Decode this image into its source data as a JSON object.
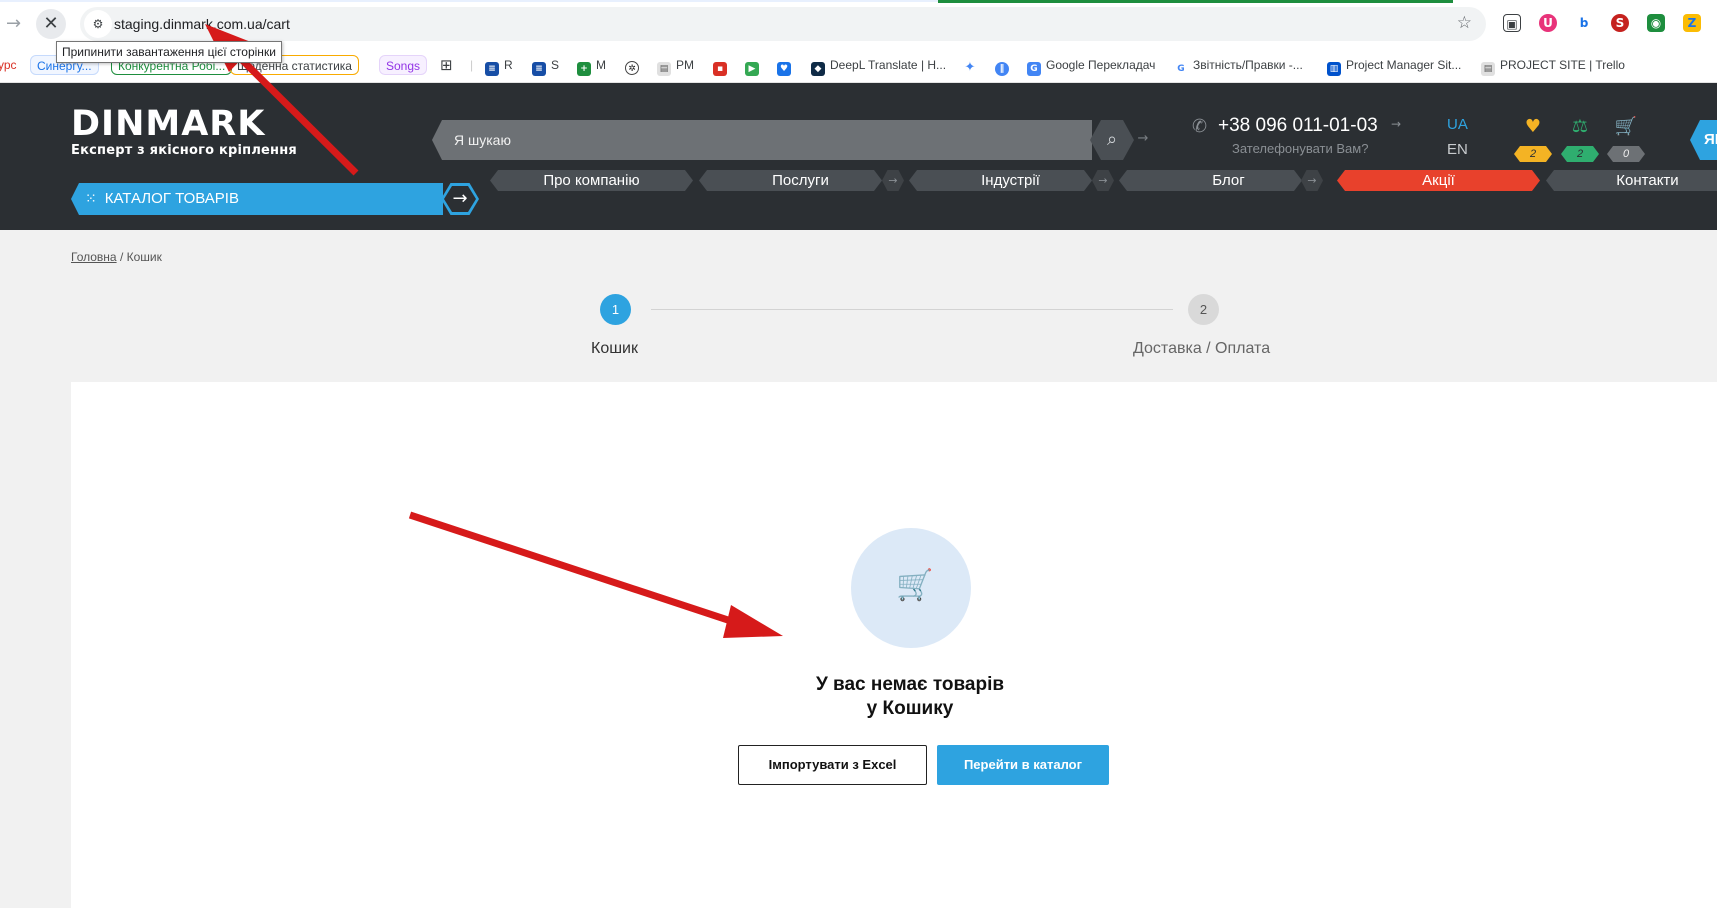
{
  "browser": {
    "url": "staging.dinmark.com.ua/cart",
    "tooltip": "Припинити завантаження цієї сторінки",
    "bookmarks": [
      {
        "label": "урс",
        "color": "#d93025"
      },
      {
        "label": "Синергу...",
        "color": "#1a73e8"
      },
      {
        "label": "Конкурентна Робі...",
        "color": "#1e8e3e"
      },
      {
        "label": "Щоденна статистика",
        "color": "#f9ab00"
      },
      {
        "label": "Songs",
        "color": "#9334e6"
      },
      {
        "label": "R",
        "color": "#174ea6"
      },
      {
        "label": "S",
        "color": "#174ea6"
      },
      {
        "label": "M",
        "color": "#1e8e3e"
      },
      {
        "label": "PM",
        "color": "#5f6368"
      },
      {
        "label": "DeepL Translate | Н...",
        "color": "#0f2b46"
      },
      {
        "label": "Google Перекладач",
        "color": "#1a73e8"
      },
      {
        "label": "Звітність/Правки -...",
        "color": "#4285f4"
      },
      {
        "label": "Project Manager Sit...",
        "color": "#0052cc"
      },
      {
        "label": "PROJECT SITE | Trello",
        "color": "#5f6368"
      }
    ]
  },
  "header": {
    "logo": "DINMARK",
    "tagline": "Експерт з якісного кріплення",
    "search_placeholder": "Я шукаю",
    "phone": "+38 096 011-01-03",
    "callback": "Зателефонувати Вам?",
    "lang_active": "UA",
    "lang_other": "EN",
    "favorites_count": "2",
    "compare_count": "2",
    "cart_count": "0",
    "side_cta": "ЯЦ",
    "catalog_label": "КАТАЛОГ ТОВАРІВ",
    "nav": {
      "about": "Про компанію",
      "services": "Послуги",
      "industries": "Індустрії",
      "blog": "Блог",
      "sales": "Акції",
      "contacts": "Контакти"
    },
    "colors": {
      "accent": "#2ea3e0",
      "sales": "#e8412c",
      "dark": "#2b2f33"
    }
  },
  "breadcrumb": {
    "home": "Головна",
    "separator": "/",
    "current": "Кошик"
  },
  "steps": [
    {
      "number": "1",
      "label": "Кошик"
    },
    {
      "number": "2",
      "label": "Доставка / Оплата"
    }
  ],
  "cart": {
    "empty_line1": "У вас немає товарів",
    "empty_line2": "у Кошику",
    "import_button": "Імпортувати з Excel",
    "catalog_button": "Перейти в каталог"
  }
}
